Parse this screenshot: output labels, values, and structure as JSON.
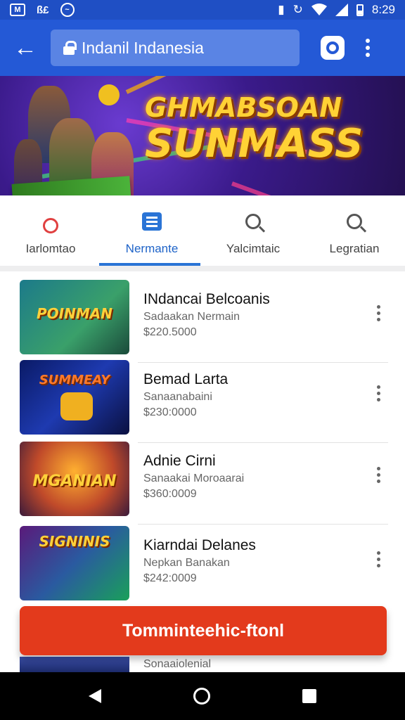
{
  "status_bar": {
    "left_icons": [
      "gmail-icon",
      "sim-icon",
      "messenger-icon"
    ],
    "sim_text": "ß£",
    "time": "8:29",
    "right_icons": [
      "vibrate-icon",
      "sync-icon",
      "wifi-icon",
      "signal-icon",
      "battery-icon"
    ]
  },
  "toolbar": {
    "url_text": "Indanil Indanesia"
  },
  "banner": {
    "title_line1": "GHMABSOAN",
    "title_line2": "SUNMASS"
  },
  "tabs": [
    {
      "label": "Iarlomtao",
      "icon": "record-icon",
      "active": false
    },
    {
      "label": "Nermante",
      "icon": "list-icon",
      "active": true
    },
    {
      "label": "Yalcimtaic",
      "icon": "search-icon",
      "active": false
    },
    {
      "label": "Legratian",
      "icon": "search-icon",
      "active": false
    }
  ],
  "items": [
    {
      "title": "INdancai Belcoanis",
      "subtitle": "Sadaakan Nermain",
      "price": "$220.5000",
      "thumb_text": "POINMAN",
      "thumb_colors": [
        "#1c7a8a",
        "#3aa06a"
      ]
    },
    {
      "title": "Bemad Larta",
      "subtitle": "Sanaanabaini",
      "price": "$230:0000",
      "thumb_text": "SUMMEAY",
      "thumb_colors": [
        "#0a1a66",
        "#1e3ab0"
      ]
    },
    {
      "title": "Adnie Cirni",
      "subtitle": "Sanaakai Moroaarai",
      "price": "$360:0009",
      "thumb_text": "MGANIAN",
      "thumb_colors": [
        "#7a2a4a",
        "#f08a2a"
      ]
    },
    {
      "title": "Kiarndai Delanes",
      "subtitle": "Nepkan Banakan",
      "price": "$242:0009",
      "thumb_text": "SIGNINIS",
      "thumb_colors": [
        "#5a1a7a",
        "#1aa05a"
      ]
    }
  ],
  "partial_item": {
    "subtitle": "Sonaaiolenial"
  },
  "cta": {
    "label": "Tomminteehic-ftonl"
  },
  "nav_bar": {
    "icons": [
      "back-triangle-icon",
      "home-circle-icon",
      "recents-square-icon"
    ]
  },
  "colors": {
    "primary": "#2459d6",
    "cta": "#e33a1c",
    "active_tab": "#1e63c8"
  }
}
